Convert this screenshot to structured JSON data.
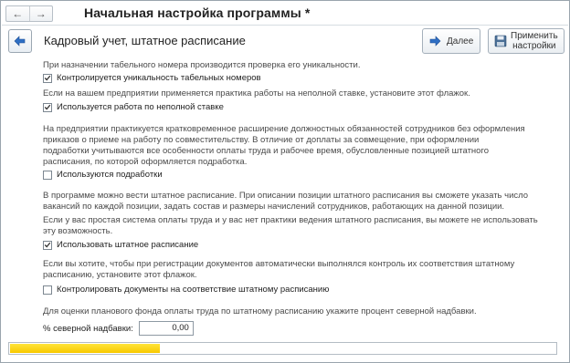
{
  "window": {
    "title": "Начальная настройка программы *",
    "nav": {
      "back_glyph": "←",
      "forward_glyph": "→"
    }
  },
  "header": {
    "title": "Кадровый учет, штатное расписание",
    "next_label": "Далее",
    "apply_label_line1": "Применить",
    "apply_label_line2": "настройки"
  },
  "sections": {
    "tabnum_text": "При назначении табельного номера производится проверка его уникальности.",
    "tabnum_checkbox": {
      "label": "Контролируется уникальность табельных номеров",
      "checked": true
    },
    "parttime_text": "Если на вашем предприятии применяется практика работы на неполной ставке, установите этот флажок.",
    "parttime_checkbox": {
      "label": "Используется работа по неполной ставке",
      "checked": true
    },
    "extra_text": [
      "На предприятии практикуется кратковременное расширение должностных обязанностей сотрудников без оформления",
      "приказов о приеме на работу по совместительству. В отличие от доплаты за совмещение, при оформлении",
      "подработки учитываются все особенности оплаты труда и рабочее время, обусловленные позицией штатного",
      "расписания, по которой оформляется подработка."
    ],
    "extra_checkbox": {
      "label": "Используются подработки",
      "checked": false
    },
    "staff_text": [
      "В программе можно вести штатное расписание. При описании позиции штатного расписания вы сможете указать число",
      "вакансий по каждой позиции, задать состав и размеры начислений сотрудников, работающих на данной позиции."
    ],
    "simple_text": [
      "Если у вас простая система оплаты труда и у вас нет практики ведения штатного расписания, вы можете не использовать",
      "эту возможность."
    ],
    "staff_checkbox": {
      "label": "Использовать штатное расписание",
      "checked": true
    },
    "control_text": [
      "Если вы хотите, чтобы при регистрации документов автоматически выполнялся контроль их соответствия штатному",
      "расписанию, установите этот флажок."
    ],
    "control_checkbox": {
      "label": "Контролировать документы на соответствие штатному расписанию",
      "checked": false
    },
    "north_text": "Для оценки планового фонда оплаты труда по штатному расписанию укажите процент северной надбавки.",
    "north_field": {
      "label": "% северной надбавки:",
      "value": "0,00"
    }
  },
  "progress": {
    "fraction": 0.275,
    "color": "#f8c800"
  },
  "icons": {
    "back": "arrow-left-icon",
    "next": "arrow-right-icon",
    "apply": "save-icon",
    "check": "checkmark-icon"
  },
  "colors": {
    "accent": "#2f6fc4",
    "progress": "#f8c800"
  }
}
